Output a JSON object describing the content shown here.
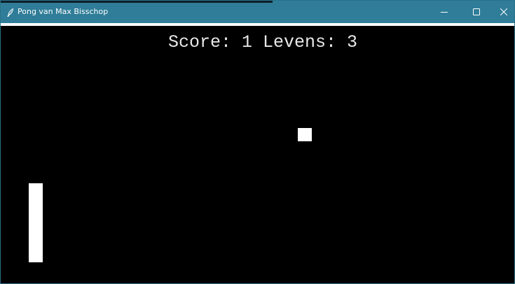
{
  "window": {
    "title": "Pong van Max Bisschop",
    "accent_color": "#2f7d98",
    "icon": "feather-icon",
    "controls": [
      "minimize-icon",
      "maximize-icon",
      "close-icon"
    ]
  },
  "game": {
    "score_label": "Score:",
    "score": "1",
    "lives_label": "Levens:",
    "lives": "3",
    "background_color": "#000000",
    "foreground_color": "#ffffff"
  }
}
